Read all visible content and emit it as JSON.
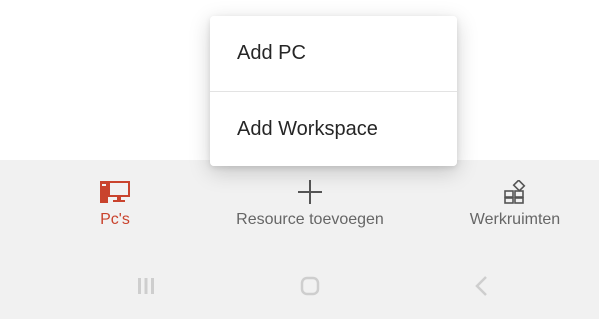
{
  "popup_menu": {
    "items": [
      {
        "label": "Add PC"
      },
      {
        "label": "Add Workspace"
      }
    ]
  },
  "bottom_nav": {
    "active_color": "#c9432d",
    "items": [
      {
        "label": "Pc's",
        "icon": "pc-icon",
        "active": true
      },
      {
        "label": "Resource toevoegen",
        "icon": "plus-icon",
        "active": false
      },
      {
        "label": "Werkruimten",
        "icon": "workspaces-icon",
        "active": false
      }
    ]
  },
  "system_nav": {
    "buttons": [
      "recents-icon",
      "home-icon",
      "back-icon"
    ]
  }
}
